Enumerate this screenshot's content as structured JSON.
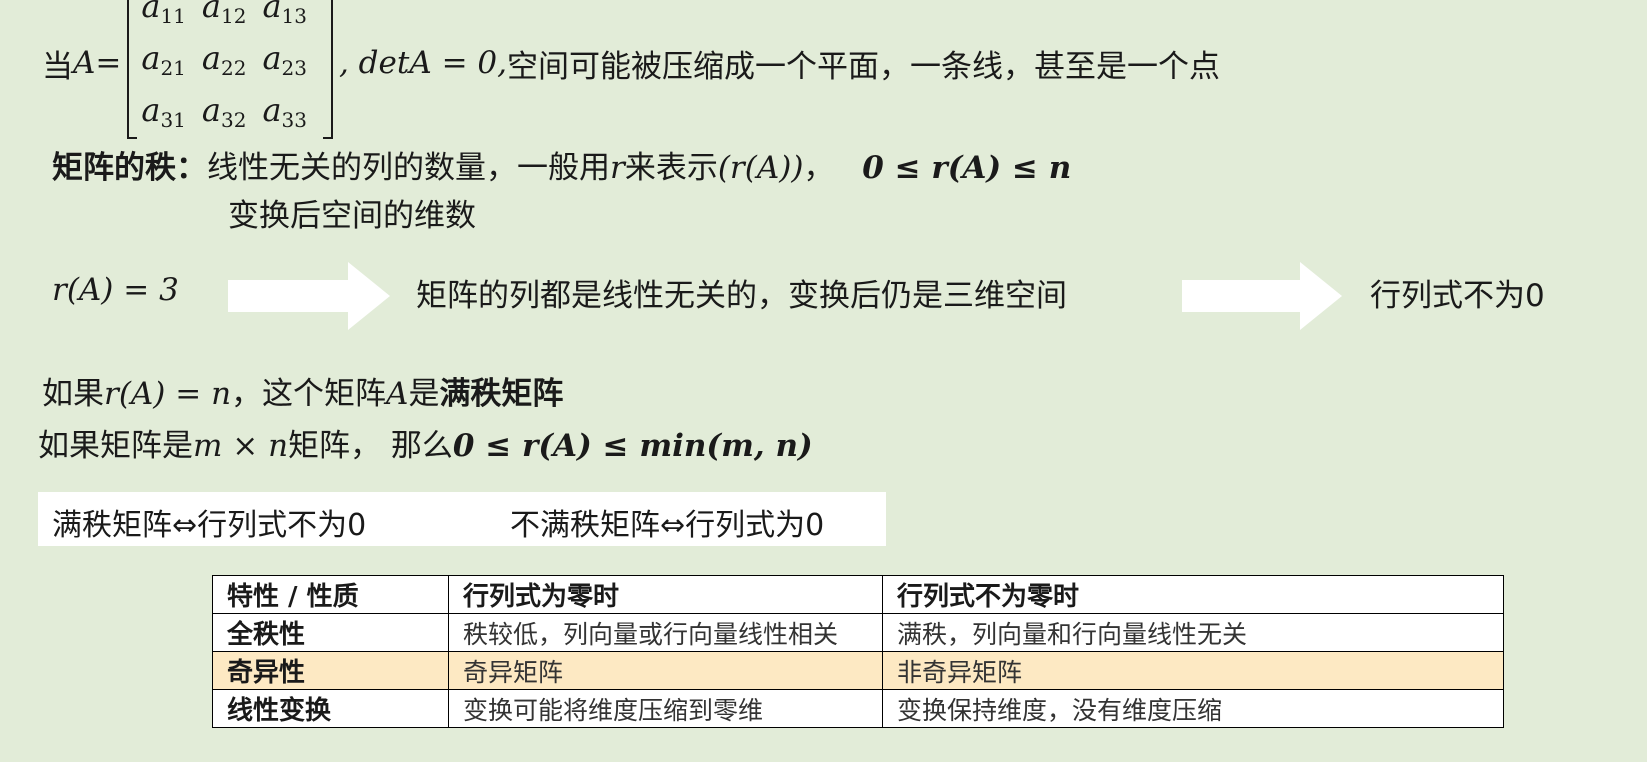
{
  "row1": {
    "prefix": "当",
    "var_a": "A",
    "eq": " = ",
    "matrix": [
      [
        {
          "b": "a",
          "s": "11"
        },
        {
          "b": "a",
          "s": "12"
        },
        {
          "b": "a",
          "s": "13"
        }
      ],
      [
        {
          "b": "a",
          "s": "21"
        },
        {
          "b": "a",
          "s": "22"
        },
        {
          "b": "a",
          "s": "23"
        }
      ],
      [
        {
          "b": "a",
          "s": "31"
        },
        {
          "b": "a",
          "s": "32"
        },
        {
          "b": "a",
          "s": "33"
        }
      ]
    ],
    "det": ", detA = 0,",
    "suffix": " 空间可能被压缩成一个平面，一条线，甚至是一个点"
  },
  "rank": {
    "term": "矩阵的秩：",
    "def_text": "线性无关的列的数量，一般用",
    "r": "r",
    "def_text2": "来表示",
    "rA": "(r(A))",
    "sep": "，",
    "bound": "0 ≤ r(A) ≤ n",
    "line2": "变换后空间的维数"
  },
  "row3": {
    "r_eq": "r(A) = 3",
    "middle": "矩阵的列都是线性无关的，变换后仍是三维空间",
    "right": "行列式不为0"
  },
  "full_rank": {
    "l1_pre": "如果",
    "l1_math": "r(A) = n",
    "l1_mid": "，这个矩阵",
    "l1_A": "A",
    "l1_is": "是",
    "l1_bold": "满秩矩阵",
    "l2_pre": "如果矩阵是",
    "l2_math": "m × n",
    "l2_mid": "矩阵，  那么",
    "l2_bound": "0 ≤ r(A) ≤ min(m, n)"
  },
  "equiv": {
    "left": "满秩矩阵⇔行列式不为0",
    "right": "不满秩矩阵⇔行列式为0"
  },
  "table": {
    "headers": [
      "特性 / 性质",
      "行列式为零时",
      "行列式不为零时"
    ],
    "rows": [
      [
        "全秩性",
        "秩较低，列向量或行向量线性相关",
        "满秩，列向量和行向量线性无关"
      ],
      [
        "奇异性",
        "奇异矩阵",
        "非奇异矩阵"
      ],
      [
        "线性变换",
        "变换可能将维度压缩到零维",
        "变换保持维度，没有维度压缩"
      ]
    ]
  },
  "colors": {
    "background": "#e2ecd8",
    "highlight_row": "#fde9c3",
    "arrow": "#ffffff"
  }
}
